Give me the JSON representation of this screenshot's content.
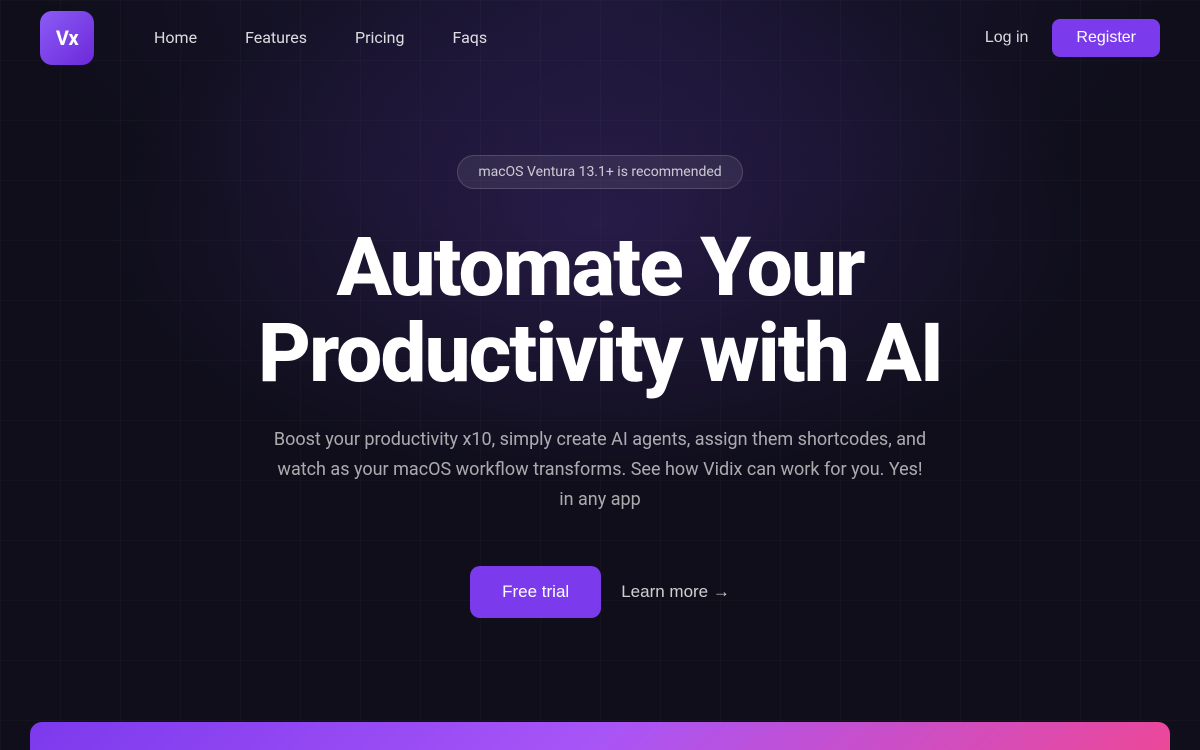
{
  "logo": {
    "text": "Vx"
  },
  "nav": {
    "links": [
      {
        "label": "Home",
        "id": "home"
      },
      {
        "label": "Features",
        "id": "features"
      },
      {
        "label": "Pricing",
        "id": "pricing"
      },
      {
        "label": "Faqs",
        "id": "faqs"
      }
    ],
    "login_label": "Log in",
    "register_label": "Register"
  },
  "hero": {
    "badge": "macOS Ventura 13.1+ is recommended",
    "title_line1": "Automate Your",
    "title_line2": "Productivity with AI",
    "subtitle": "Boost your productivity x10, simply create AI agents, assign them shortcodes, and watch as your macOS workflow transforms. See how Vidix can work for you. Yes! in any app",
    "cta_primary": "Free trial",
    "cta_secondary": "Learn more →"
  }
}
